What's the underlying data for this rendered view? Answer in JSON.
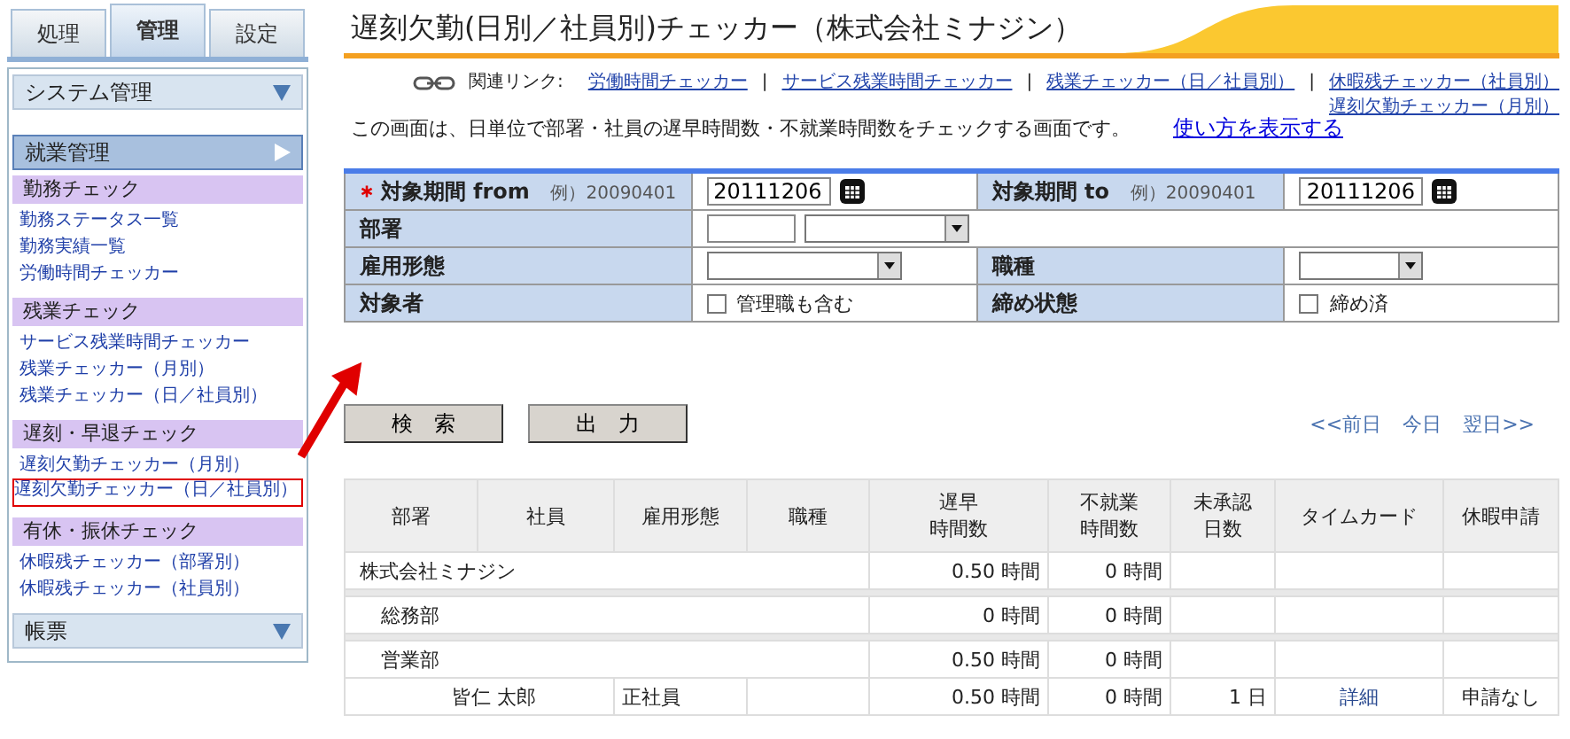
{
  "nav_tabs": [
    {
      "label": "処理",
      "selected": false
    },
    {
      "label": "管理",
      "selected": true
    },
    {
      "label": "設定",
      "selected": false
    }
  ],
  "sidebar": [
    {
      "title": "システム管理",
      "active": false
    },
    {
      "title": "就業管理",
      "active": true,
      "groups": [
        {
          "title": "勤務チェック",
          "items": [
            {
              "label": "勤務ステータス一覧",
              "selected": false
            },
            {
              "label": "勤務実績一覧",
              "selected": false
            },
            {
              "label": "労働時間チェッカー",
              "selected": false
            }
          ]
        },
        {
          "title": "残業チェック",
          "items": [
            {
              "label": "サービス残業時間チェッカー",
              "selected": false
            },
            {
              "label": "残業チェッカー（月別）",
              "selected": false
            },
            {
              "label": "残業チェッカー（日／社員別）",
              "selected": false
            }
          ]
        },
        {
          "title": "遅刻・早退チェック",
          "items": [
            {
              "label": "遅刻欠勤チェッカー（月別）",
              "selected": false
            },
            {
              "label": "遅刻欠勤チェッカー（日／社員別）",
              "selected": true
            }
          ]
        },
        {
          "title": "有休・振休チェック",
          "items": [
            {
              "label": "休暇残チェッカー（部署別）",
              "selected": false
            },
            {
              "label": "休暇残チェッカー（社員別）",
              "selected": false
            }
          ]
        }
      ]
    },
    {
      "title": "帳票",
      "active": false
    }
  ],
  "title": "遅刻欠勤(日別／社員別)チェッカー（株式会社ミナジン）",
  "related_links": {
    "label": "関連リンク:",
    "separator": "|",
    "lines": [
      [
        "労働時間チェッカー",
        "サービス残業時間チェッカー",
        "残業チェッカー（日／社員別）",
        "休暇残チェッカー（社員別）"
      ],
      [
        "遅刻欠勤チェッカー（月別）"
      ]
    ]
  },
  "description": "この画面は、日単位で部署・社員の遅早時間数・不就業時間数をチェックする画面です。",
  "help_link": "使い方を表示する",
  "search_form": {
    "period_from": {
      "label": "対象期間 from",
      "required": true,
      "example": "例）20090401",
      "value": "20111206"
    },
    "period_to": {
      "label": "対象期間 to",
      "example": "例）20090401",
      "value": "20111206"
    },
    "department": {
      "label": "部署"
    },
    "employment_type": {
      "label": "雇用形態"
    },
    "job_type": {
      "label": "職種"
    },
    "target": {
      "label": "対象者",
      "option": "管理職も含む",
      "checked": false
    },
    "closing": {
      "label": "締め状態",
      "option": "締め済",
      "checked": false
    }
  },
  "buttons": [
    "検　索",
    "出　力"
  ],
  "day_nav": [
    "<<前日",
    "今日",
    "翌日>>"
  ],
  "table": {
    "columns": [
      [
        "部署"
      ],
      [
        "社員"
      ],
      [
        "雇用形態"
      ],
      [
        "職種"
      ],
      [
        "遅早",
        "時間数"
      ],
      [
        "不就業",
        "時間数"
      ],
      [
        "未承認",
        "日数"
      ],
      [
        "タイムカード"
      ],
      [
        "休暇申請"
      ]
    ],
    "rows": [
      {
        "kind": "company",
        "name": "株式会社ミナジン",
        "late": "0.50 時間",
        "absent": "0 時間"
      },
      {
        "kind": "department",
        "name": "総務部",
        "late": "0 時間",
        "absent": "0 時間"
      },
      {
        "kind": "department",
        "name": "営業部",
        "late": "0.50 時間",
        "absent": "0 時間"
      },
      {
        "kind": "employee",
        "name": "皆仁 太郎",
        "employment": "正社員",
        "late": "0.50 時間",
        "absent": "0 時間",
        "unapproved": "1 日",
        "timecard": "詳細",
        "leave": "申請なし"
      }
    ]
  }
}
